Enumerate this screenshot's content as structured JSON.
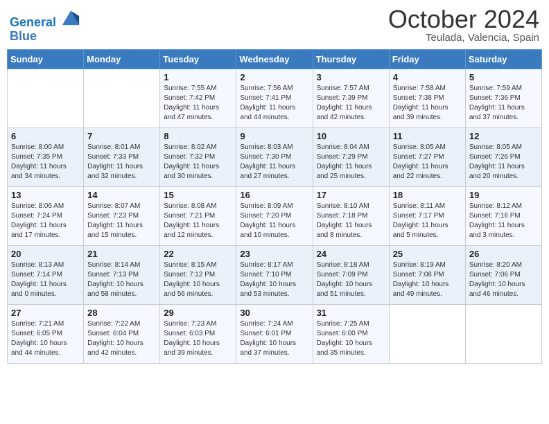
{
  "header": {
    "logo_line1": "General",
    "logo_line2": "Blue",
    "month": "October 2024",
    "location": "Teulada, Valencia, Spain"
  },
  "weekdays": [
    "Sunday",
    "Monday",
    "Tuesday",
    "Wednesday",
    "Thursday",
    "Friday",
    "Saturday"
  ],
  "weeks": [
    [
      {
        "day": "",
        "info": ""
      },
      {
        "day": "",
        "info": ""
      },
      {
        "day": "1",
        "info": "Sunrise: 7:55 AM\nSunset: 7:42 PM\nDaylight: 11 hours and 47 minutes."
      },
      {
        "day": "2",
        "info": "Sunrise: 7:56 AM\nSunset: 7:41 PM\nDaylight: 11 hours and 44 minutes."
      },
      {
        "day": "3",
        "info": "Sunrise: 7:57 AM\nSunset: 7:39 PM\nDaylight: 11 hours and 42 minutes."
      },
      {
        "day": "4",
        "info": "Sunrise: 7:58 AM\nSunset: 7:38 PM\nDaylight: 11 hours and 39 minutes."
      },
      {
        "day": "5",
        "info": "Sunrise: 7:59 AM\nSunset: 7:36 PM\nDaylight: 11 hours and 37 minutes."
      }
    ],
    [
      {
        "day": "6",
        "info": "Sunrise: 8:00 AM\nSunset: 7:35 PM\nDaylight: 11 hours and 34 minutes."
      },
      {
        "day": "7",
        "info": "Sunrise: 8:01 AM\nSunset: 7:33 PM\nDaylight: 11 hours and 32 minutes."
      },
      {
        "day": "8",
        "info": "Sunrise: 8:02 AM\nSunset: 7:32 PM\nDaylight: 11 hours and 30 minutes."
      },
      {
        "day": "9",
        "info": "Sunrise: 8:03 AM\nSunset: 7:30 PM\nDaylight: 11 hours and 27 minutes."
      },
      {
        "day": "10",
        "info": "Sunrise: 8:04 AM\nSunset: 7:29 PM\nDaylight: 11 hours and 25 minutes."
      },
      {
        "day": "11",
        "info": "Sunrise: 8:05 AM\nSunset: 7:27 PM\nDaylight: 11 hours and 22 minutes."
      },
      {
        "day": "12",
        "info": "Sunrise: 8:05 AM\nSunset: 7:26 PM\nDaylight: 11 hours and 20 minutes."
      }
    ],
    [
      {
        "day": "13",
        "info": "Sunrise: 8:06 AM\nSunset: 7:24 PM\nDaylight: 11 hours and 17 minutes."
      },
      {
        "day": "14",
        "info": "Sunrise: 8:07 AM\nSunset: 7:23 PM\nDaylight: 11 hours and 15 minutes."
      },
      {
        "day": "15",
        "info": "Sunrise: 8:08 AM\nSunset: 7:21 PM\nDaylight: 11 hours and 12 minutes."
      },
      {
        "day": "16",
        "info": "Sunrise: 8:09 AM\nSunset: 7:20 PM\nDaylight: 11 hours and 10 minutes."
      },
      {
        "day": "17",
        "info": "Sunrise: 8:10 AM\nSunset: 7:18 PM\nDaylight: 11 hours and 8 minutes."
      },
      {
        "day": "18",
        "info": "Sunrise: 8:11 AM\nSunset: 7:17 PM\nDaylight: 11 hours and 5 minutes."
      },
      {
        "day": "19",
        "info": "Sunrise: 8:12 AM\nSunset: 7:16 PM\nDaylight: 11 hours and 3 minutes."
      }
    ],
    [
      {
        "day": "20",
        "info": "Sunrise: 8:13 AM\nSunset: 7:14 PM\nDaylight: 11 hours and 0 minutes."
      },
      {
        "day": "21",
        "info": "Sunrise: 8:14 AM\nSunset: 7:13 PM\nDaylight: 10 hours and 58 minutes."
      },
      {
        "day": "22",
        "info": "Sunrise: 8:15 AM\nSunset: 7:12 PM\nDaylight: 10 hours and 56 minutes."
      },
      {
        "day": "23",
        "info": "Sunrise: 8:17 AM\nSunset: 7:10 PM\nDaylight: 10 hours and 53 minutes."
      },
      {
        "day": "24",
        "info": "Sunrise: 8:18 AM\nSunset: 7:09 PM\nDaylight: 10 hours and 51 minutes."
      },
      {
        "day": "25",
        "info": "Sunrise: 8:19 AM\nSunset: 7:08 PM\nDaylight: 10 hours and 49 minutes."
      },
      {
        "day": "26",
        "info": "Sunrise: 8:20 AM\nSunset: 7:06 PM\nDaylight: 10 hours and 46 minutes."
      }
    ],
    [
      {
        "day": "27",
        "info": "Sunrise: 7:21 AM\nSunset: 6:05 PM\nDaylight: 10 hours and 44 minutes."
      },
      {
        "day": "28",
        "info": "Sunrise: 7:22 AM\nSunset: 6:04 PM\nDaylight: 10 hours and 42 minutes."
      },
      {
        "day": "29",
        "info": "Sunrise: 7:23 AM\nSunset: 6:03 PM\nDaylight: 10 hours and 39 minutes."
      },
      {
        "day": "30",
        "info": "Sunrise: 7:24 AM\nSunset: 6:01 PM\nDaylight: 10 hours and 37 minutes."
      },
      {
        "day": "31",
        "info": "Sunrise: 7:25 AM\nSunset: 6:00 PM\nDaylight: 10 hours and 35 minutes."
      },
      {
        "day": "",
        "info": ""
      },
      {
        "day": "",
        "info": ""
      }
    ]
  ]
}
